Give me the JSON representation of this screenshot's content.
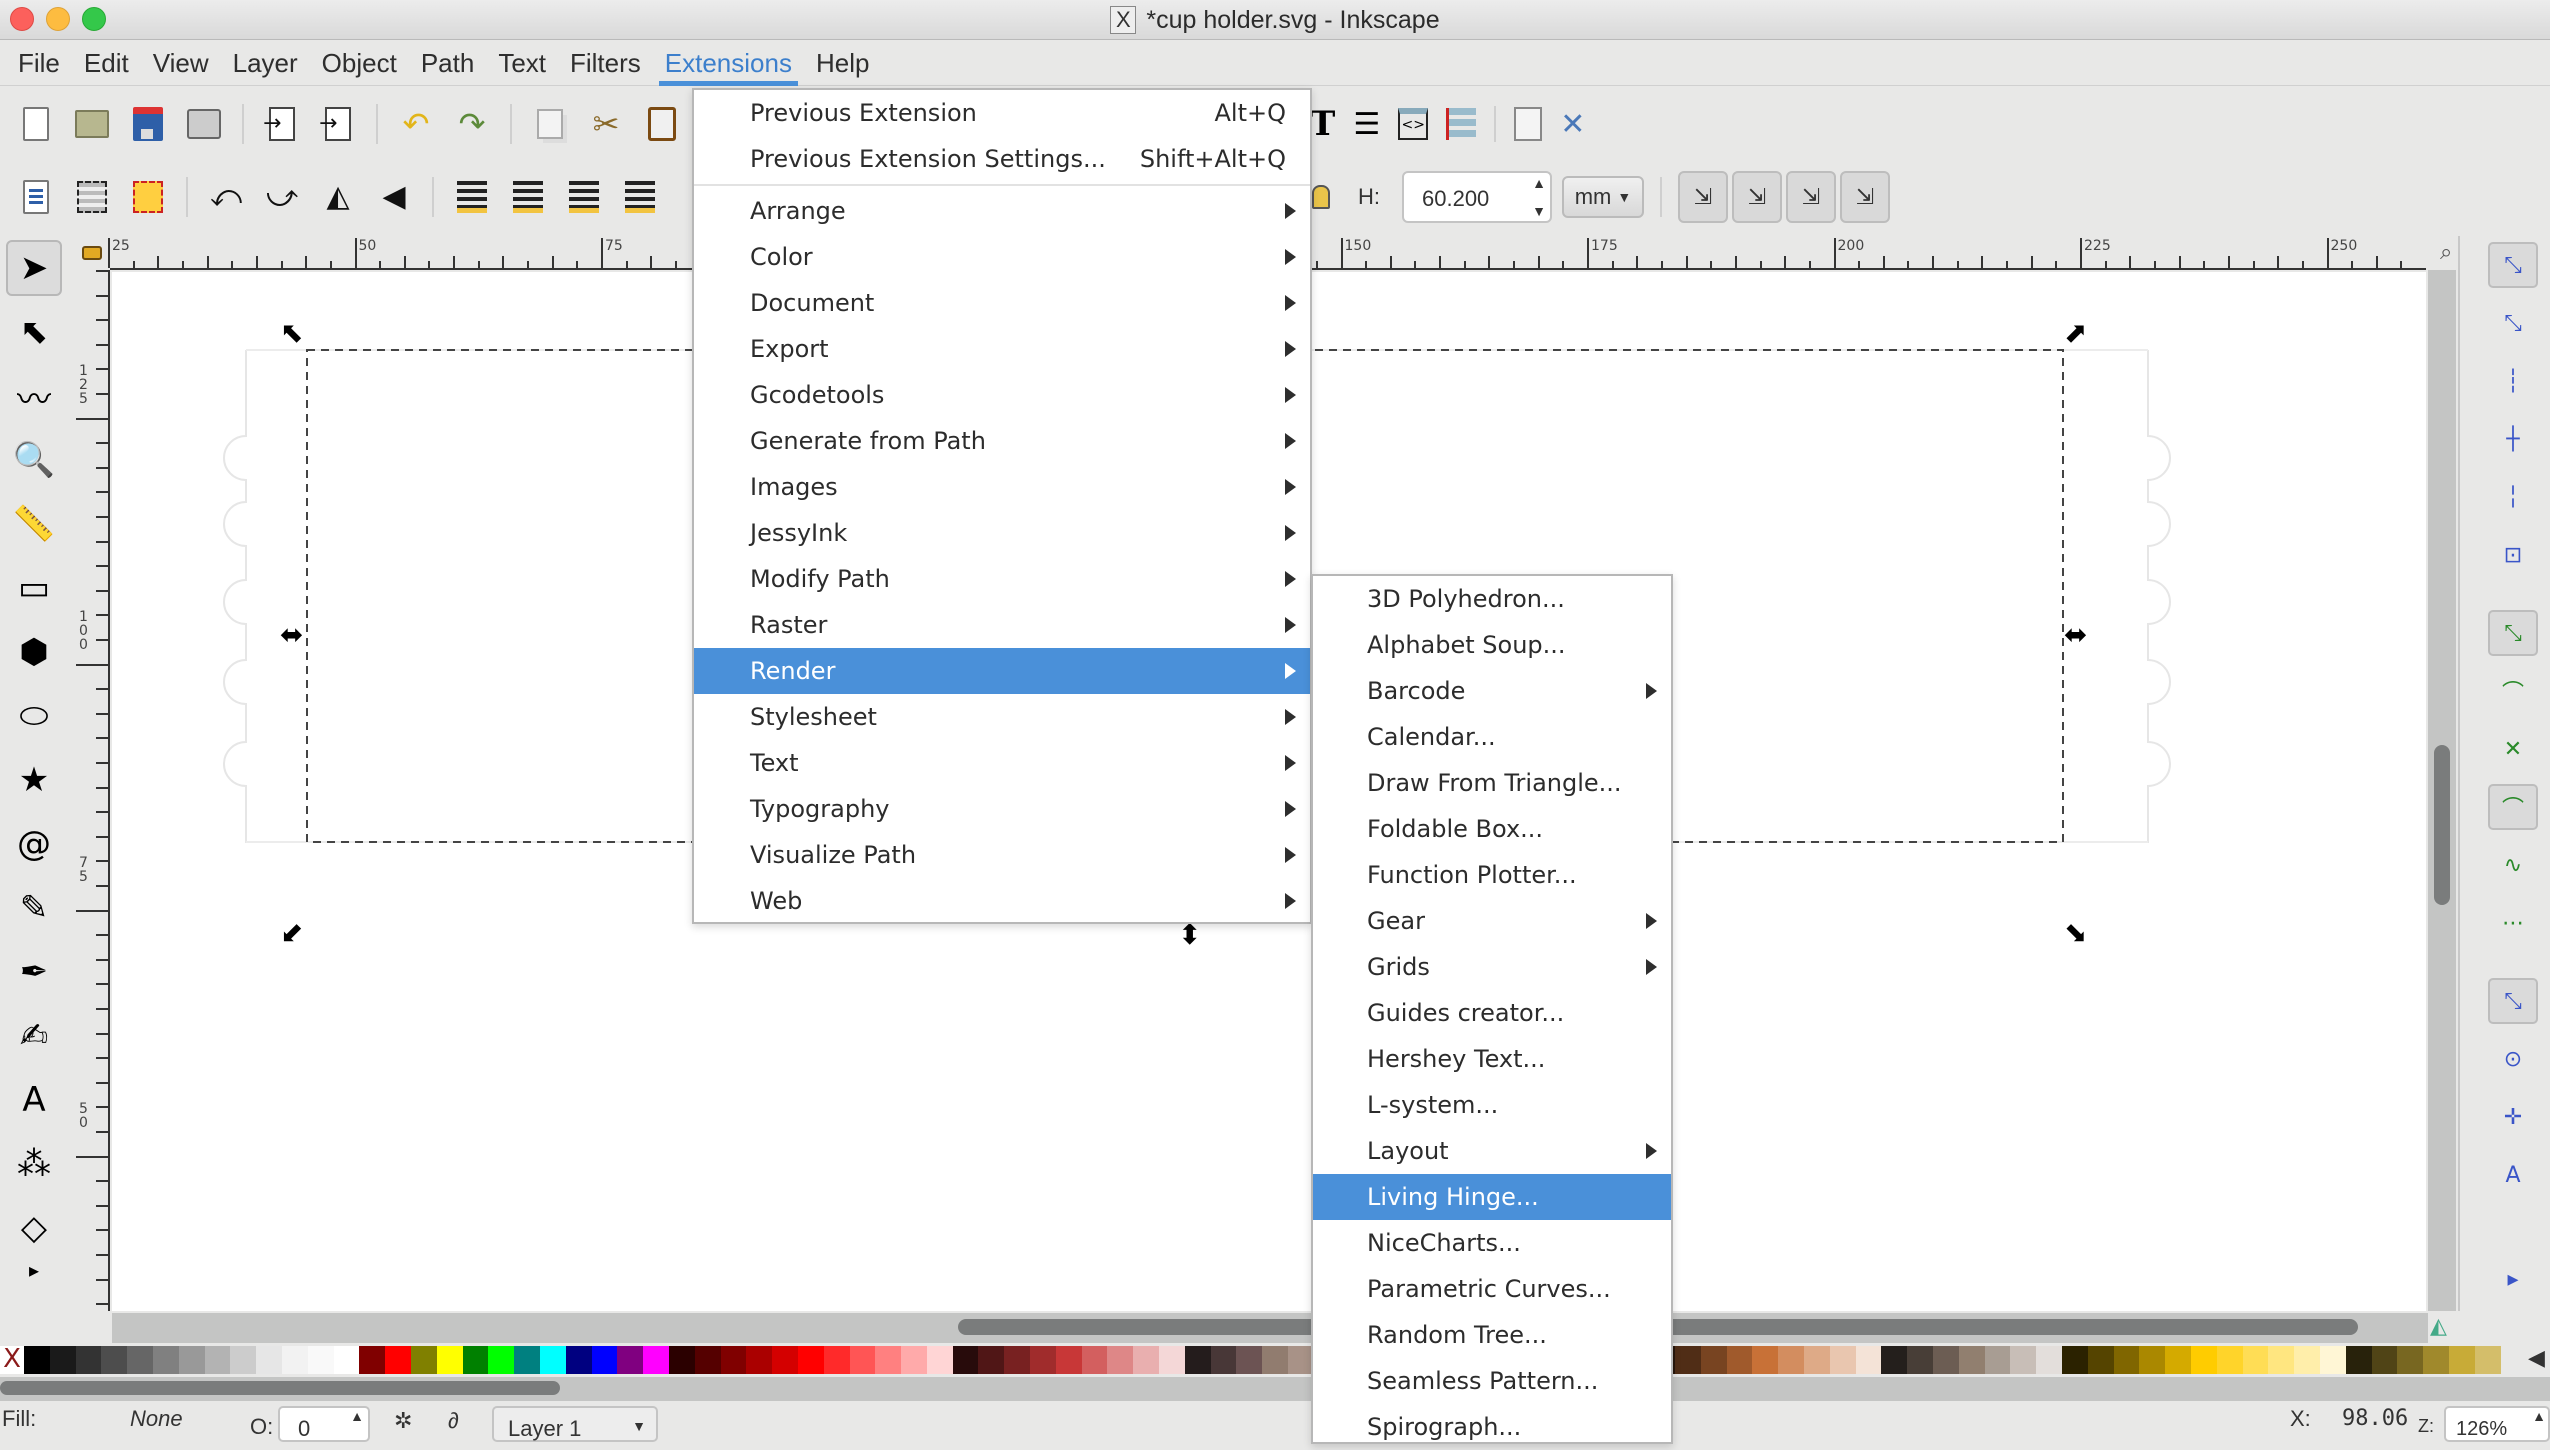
{
  "window": {
    "title": "*cup holder.svg - Inkscape",
    "x_icon": "X"
  },
  "menubar": {
    "items": [
      "File",
      "Edit",
      "View",
      "Layer",
      "Object",
      "Path",
      "Text",
      "Filters",
      "Extensions",
      "Help"
    ],
    "active": "Extensions"
  },
  "toolbar1": {
    "icons": [
      "new-document-icon",
      "open-folder-icon",
      "save-icon",
      "print-icon",
      "import-icon",
      "export-icon",
      "undo-icon",
      "redo-icon",
      "duplicate-icon",
      "cut-icon",
      "paste-icon",
      "text-tool-icon",
      "layers-icon",
      "xml-editor-icon",
      "align-icon",
      "document-properties-icon",
      "preferences-icon"
    ]
  },
  "toolbar2": {
    "icons": [
      "select-all-icon",
      "select-all-layers-icon",
      "deselect-icon",
      "rotate-ccw-icon",
      "rotate-cw-icon",
      "flip-horizontal-icon",
      "flip-vertical-icon",
      "lower-to-bottom-icon",
      "lower-icon",
      "raise-icon",
      "raise-to-top-icon"
    ],
    "h_label": "H:",
    "h_value": "60.200",
    "unit": "mm",
    "transform_toggles": [
      "scale-stroke-icon",
      "scale-corners-icon",
      "transform-gradients-icon",
      "transform-patterns-icon"
    ]
  },
  "ruler": {
    "top_labels": [
      {
        "value": "25"
      },
      {
        "value": "50"
      },
      {
        "value": "75"
      },
      {
        "value": "150"
      },
      {
        "value": "175"
      },
      {
        "value": "200"
      },
      {
        "value": "225"
      },
      {
        "value": "250"
      }
    ],
    "left_labels": [
      {
        "value": "125"
      },
      {
        "value": "100"
      },
      {
        "value": "75"
      },
      {
        "value": "50"
      }
    ]
  },
  "toolbox": {
    "tools": [
      {
        "name": "selector-tool",
        "glyph": "➤",
        "active": true
      },
      {
        "name": "node-tool",
        "glyph": "⬉"
      },
      {
        "name": "tweak-tool",
        "glyph": "〰"
      },
      {
        "name": "zoom-tool",
        "glyph": "🔍"
      },
      {
        "name": "measure-tool",
        "glyph": "📏"
      },
      {
        "name": "rectangle-tool",
        "glyph": "▭"
      },
      {
        "name": "3d-box-tool",
        "glyph": "⬢"
      },
      {
        "name": "ellipse-tool",
        "glyph": "⬭"
      },
      {
        "name": "star-tool",
        "glyph": "★"
      },
      {
        "name": "spiral-tool",
        "glyph": "@"
      },
      {
        "name": "pencil-tool",
        "glyph": "✎"
      },
      {
        "name": "pen-tool",
        "glyph": "✒"
      },
      {
        "name": "calligraphy-tool",
        "glyph": "✍"
      },
      {
        "name": "text-tool",
        "glyph": "A"
      },
      {
        "name": "spray-tool",
        "glyph": "⁂"
      },
      {
        "name": "eraser-tool",
        "glyph": "◇"
      },
      {
        "name": "more-tools",
        "glyph": "▸"
      }
    ]
  },
  "snapbar": {
    "items": [
      {
        "name": "snap-enable",
        "glyph": "⤡",
        "on": true
      },
      {
        "name": "snap-bbox",
        "glyph": "⤡"
      },
      {
        "name": "snap-bbox-edge",
        "glyph": "┆"
      },
      {
        "name": "snap-bbox-corner",
        "glyph": "┼"
      },
      {
        "name": "snap-bbox-edge-midpoint",
        "glyph": "╎"
      },
      {
        "name": "snap-bbox-center",
        "glyph": "⊡"
      },
      {
        "name": "snap-nodes",
        "glyph": "⤡",
        "on": true
      },
      {
        "name": "snap-paths",
        "glyph": "⌒"
      },
      {
        "name": "snap-path-intersections",
        "glyph": "✕"
      },
      {
        "name": "snap-cusp-nodes",
        "glyph": "⌒",
        "on": true
      },
      {
        "name": "snap-smooth-nodes",
        "glyph": "∿"
      },
      {
        "name": "snap-line-midpoints",
        "glyph": "⋯"
      },
      {
        "name": "snap-others",
        "glyph": "⤡",
        "on": true
      },
      {
        "name": "snap-object-centers",
        "glyph": "⊙"
      },
      {
        "name": "snap-rotation-centers",
        "glyph": "✛"
      },
      {
        "name": "snap-text-baseline",
        "glyph": "A"
      },
      {
        "name": "more-snap",
        "glyph": "▸"
      }
    ]
  },
  "extensions_menu": {
    "top_items": [
      {
        "label": "Previous Extension",
        "shortcut": "Alt+Q"
      },
      {
        "label": "Previous Extension Settings...",
        "shortcut": "Shift+Alt+Q"
      }
    ],
    "items": [
      {
        "label": "Arrange",
        "submenu": true
      },
      {
        "label": "Color",
        "submenu": true
      },
      {
        "label": "Document",
        "submenu": true
      },
      {
        "label": "Export",
        "submenu": true
      },
      {
        "label": "Gcodetools",
        "submenu": true
      },
      {
        "label": "Generate from Path",
        "submenu": true
      },
      {
        "label": "Images",
        "submenu": true
      },
      {
        "label": "JessyInk",
        "submenu": true
      },
      {
        "label": "Modify Path",
        "submenu": true
      },
      {
        "label": "Raster",
        "submenu": true
      },
      {
        "label": "Render",
        "submenu": true,
        "highlighted": true
      },
      {
        "label": "Stylesheet",
        "submenu": true
      },
      {
        "label": "Text",
        "submenu": true
      },
      {
        "label": "Typography",
        "submenu": true
      },
      {
        "label": "Visualize Path",
        "submenu": true
      },
      {
        "label": "Web",
        "submenu": true
      }
    ]
  },
  "render_menu": {
    "items": [
      {
        "label": "3D Polyhedron..."
      },
      {
        "label": "Alphabet Soup..."
      },
      {
        "label": "Barcode",
        "submenu": true
      },
      {
        "label": "Calendar..."
      },
      {
        "label": "Draw From Triangle..."
      },
      {
        "label": "Foldable Box..."
      },
      {
        "label": "Function Plotter..."
      },
      {
        "label": "Gear",
        "submenu": true
      },
      {
        "label": "Grids",
        "submenu": true
      },
      {
        "label": "Guides creator..."
      },
      {
        "label": "Hershey Text..."
      },
      {
        "label": "L-system..."
      },
      {
        "label": "Layout",
        "submenu": true
      },
      {
        "label": "Living Hinge...",
        "highlighted": true
      },
      {
        "label": "NiceCharts..."
      },
      {
        "label": "Parametric Curves..."
      },
      {
        "label": "Random Tree..."
      },
      {
        "label": "Seamless Pattern..."
      },
      {
        "label": "Spirograph..."
      }
    ]
  },
  "palette": {
    "colors": [
      "#000000",
      "#1a1a1a",
      "#333333",
      "#4d4d4d",
      "#666666",
      "#808080",
      "#999999",
      "#b3b3b3",
      "#cccccc",
      "#e6e6e6",
      "#f2f2f2",
      "#f9f9f9",
      "#ffffff",
      "#800000",
      "#ff0000",
      "#808000",
      "#ffff00",
      "#008000",
      "#00ff00",
      "#008080",
      "#00ffff",
      "#000080",
      "#0000ff",
      "#800080",
      "#ff00ff",
      "#2b0000",
      "#550000",
      "#800000",
      "#aa0000",
      "#d40000",
      "#ff0000",
      "#ff2a2a",
      "#ff5555",
      "#ff8080",
      "#ffaaaa",
      "#ffd5d5",
      "#280b0b",
      "#501616",
      "#782121",
      "#a02c2c",
      "#c83737",
      "#d35f5f",
      "#de8787",
      "#e9afaf",
      "#f4d7d7",
      "#241c1c",
      "#483737",
      "#6c5353",
      "#917c6f",
      "#a89287",
      "#c8b7b7",
      "#e3dbdb",
      "#ffe6d5",
      "#ffd5c8",
      "#f9c0a0",
      "#f4a480",
      "#eb8f60",
      "#d8743f",
      "#c75e2b",
      "#aa4400",
      "#803300",
      "#552200",
      "#2b1100",
      "#28170b",
      "#502d16",
      "#784421",
      "#a05a2c",
      "#c87137",
      "#d38d5f",
      "#deaa87",
      "#e9c6af",
      "#f4e3d7",
      "#241f1c",
      "#483e37",
      "#6c5d53",
      "#917f6f",
      "#a89d93",
      "#c8beb7",
      "#e3dedb",
      "#2b2200",
      "#554400",
      "#806600",
      "#aa8800",
      "#d4aa00",
      "#ffcc00",
      "#ffd42a",
      "#ffdd55",
      "#ffe680",
      "#ffeeaa",
      "#fff6d5",
      "#28220b",
      "#504416",
      "#786721",
      "#a0892c",
      "#c8ab37",
      "#d4be6a"
    ]
  },
  "statusbar": {
    "fill_label": "Fill:",
    "fill_value": "None",
    "opacity_label": "O:",
    "opacity_value": "0",
    "layer_value": "Layer 1",
    "x_label": "X:",
    "x_value": "98.06",
    "zoom_label": "Z:",
    "zoom_value": "126%"
  },
  "colors": {
    "accent": "#4a90d9",
    "menu_bg": "#ffffff",
    "chrome_bg": "#e8e8e7"
  }
}
